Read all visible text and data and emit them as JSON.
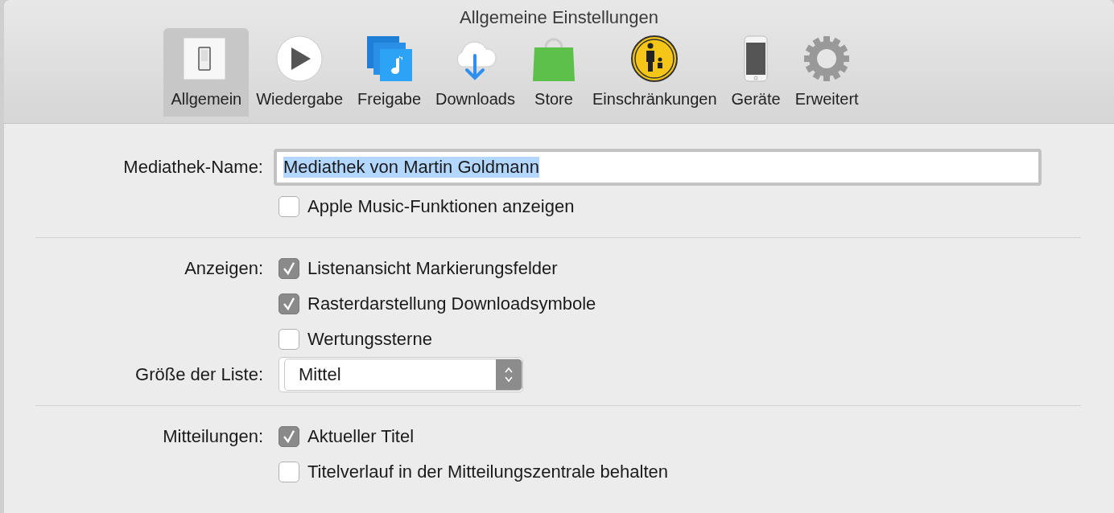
{
  "window": {
    "title": "Allgemeine Einstellungen"
  },
  "tabs": [
    {
      "label": "Allgemein",
      "kind": "switch",
      "selected": true
    },
    {
      "label": "Wiedergabe",
      "kind": "play",
      "selected": false
    },
    {
      "label": "Freigabe",
      "kind": "share",
      "selected": false
    },
    {
      "label": "Downloads",
      "kind": "download",
      "selected": false
    },
    {
      "label": "Store",
      "kind": "bag",
      "selected": false
    },
    {
      "label": "Einschränkungen",
      "kind": "parental",
      "selected": false
    },
    {
      "label": "Geräte",
      "kind": "phone",
      "selected": false
    },
    {
      "label": "Erweitert",
      "kind": "gear",
      "selected": false
    }
  ],
  "sections": [
    {
      "rows": [
        {
          "kind": "text",
          "label": "Mediathek-Name:",
          "value": "Mediathek von Martin Goldmann",
          "text_selected": true
        },
        {
          "kind": "checkbox",
          "text": "Apple Music-Funktionen anzeigen",
          "checked": false
        }
      ]
    },
    {
      "rows": [
        {
          "kind": "checkbox",
          "label": "Anzeigen:",
          "text": "Listenansicht Markierungsfelder",
          "checked": true
        },
        {
          "kind": "checkbox",
          "text": "Rasterdarstellung Downloadsymbole",
          "checked": true
        },
        {
          "kind": "checkbox",
          "text": "Wertungssterne",
          "checked": false
        },
        {
          "kind": "select",
          "label": "Größe der Liste:",
          "value": "Mittel"
        }
      ]
    },
    {
      "rows": [
        {
          "kind": "checkbox",
          "label": "Mitteilungen:",
          "text": "Aktueller Titel",
          "checked": true
        },
        {
          "kind": "checkbox",
          "text": "Titelverlauf in der Mitteilungszentrale behalten",
          "checked": false
        }
      ]
    }
  ]
}
